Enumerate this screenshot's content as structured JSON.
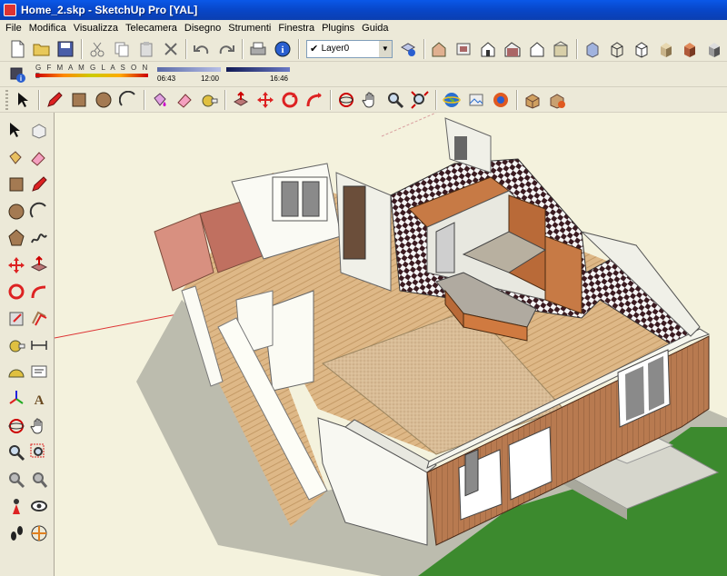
{
  "window": {
    "title": "Home_2.skp - SketchUp Pro [YAL]"
  },
  "menu": [
    "File",
    "Modifica",
    "Visualizza",
    "Telecamera",
    "Disegno",
    "Strumenti",
    "Finestra",
    "Plugins",
    "Guida"
  ],
  "layer": {
    "selected": "Layer0",
    "check": "✔"
  },
  "shadows": {
    "months": "G F M A M G L A S O N D",
    "time_start": "06:43",
    "time_mid": "12:00",
    "time_end": "16:46"
  },
  "colors": {
    "titlebar": "#0846c8",
    "toolbar_bg": "#ece9d8",
    "viewport_bg": "#f4f2dd",
    "floor_wood": "#deb887",
    "wall_brown": "#b87a50",
    "grass": "#3c8a2e",
    "shadow": "#bcbcae"
  },
  "toolbar_row1_icons": [
    "new-file-icon",
    "open-folder-icon",
    "save-icon",
    "cut-icon",
    "copy-icon",
    "paste-icon",
    "erase-icon",
    "undo-icon",
    "redo-icon",
    "print-icon",
    "model-info-icon",
    "layers-icon",
    "iso-view-icon",
    "top-view-icon",
    "front-view-icon",
    "right-view-icon",
    "back-view-icon",
    "left-view-icon",
    "xray-icon",
    "wireframe-icon",
    "hidden-line-icon",
    "shaded-icon",
    "shaded-texture-icon",
    "monochrome-icon"
  ],
  "toolbar_row2_icons": [
    "shadow-settings-icon"
  ],
  "toolbar_row3_icons": [
    "select-icon",
    "pencil-icon",
    "rectangle-icon",
    "circle-icon",
    "arc-icon",
    "paint-bucket-icon",
    "eraser-icon",
    "tape-measure-icon",
    "push-pull-icon",
    "move-icon",
    "rotate-icon",
    "follow-me-icon",
    "orbit-icon",
    "pan-icon",
    "zoom-icon",
    "zoom-extents-icon",
    "google-earth-icon",
    "photo-texture-icon",
    "warehouse-icon",
    "component-icon",
    "share-component-icon"
  ],
  "left_tools": [
    "select-icon",
    "make-component-icon",
    "paint-bucket-icon",
    "eraser-icon",
    "rectangle-icon",
    "line-icon",
    "circle-icon",
    "arc-icon",
    "polygon-icon",
    "freehand-icon",
    "move-icon",
    "push-pull-icon",
    "rotate-icon",
    "follow-me-icon",
    "scale-icon",
    "offset-icon",
    "tape-measure-icon",
    "dimension-icon",
    "protractor-icon",
    "text-icon",
    "axes-icon",
    "3d-text-icon",
    "orbit-icon",
    "pan-icon",
    "zoom-icon",
    "zoom-window-icon",
    "previous-view-icon",
    "next-view-icon",
    "position-camera-icon",
    "look-around-icon",
    "walk-icon",
    "section-plane-icon"
  ]
}
